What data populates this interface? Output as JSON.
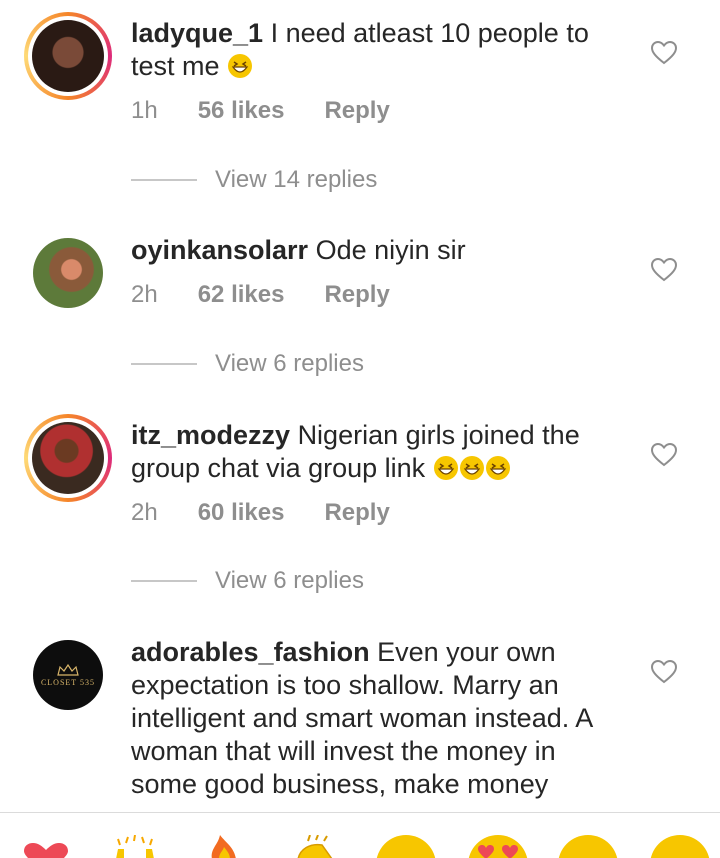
{
  "comments": [
    {
      "username": "ladyque_1",
      "text": "I need atleast 10 people to test me",
      "emoji_count": 1,
      "time": "1h",
      "likes": "56 likes",
      "reply": "Reply",
      "view_replies": "View 14 replies",
      "has_story_ring": true
    },
    {
      "username": "oyinkansolarr",
      "text": "Ode niyin sir",
      "emoji_count": 0,
      "time": "2h",
      "likes": "62 likes",
      "reply": "Reply",
      "view_replies": "View 6 replies",
      "has_story_ring": false
    },
    {
      "username": "itz_modezzy",
      "text": "Nigerian girls joined the group chat via group link",
      "emoji_count": 3,
      "time": "2h",
      "likes": "60 likes",
      "reply": "Reply",
      "view_replies": "View 6 replies",
      "has_story_ring": true
    },
    {
      "username": "adorables_fashion",
      "text": "Even your own expectation is too shallow. Marry an intelligent and smart woman instead. A woman that will invest the money in some good business, make money",
      "avatar_logo_text": "CLOSET 535",
      "has_story_ring": false
    }
  ],
  "icons": {
    "heart": "heart-outline-icon",
    "emoji_bar": [
      "red-heart-emoji",
      "raising-hands-emoji",
      "fire-emoji",
      "clapping-hands-emoji",
      "crying-laughing-emoji",
      "heart-eyes-emoji",
      "open-mouth-emoji",
      "grinning-emoji"
    ]
  },
  "colors": {
    "text": "#262626",
    "meta": "#8e8e8e",
    "ring_start": "#f58529",
    "ring_end": "#dd2a7b"
  }
}
